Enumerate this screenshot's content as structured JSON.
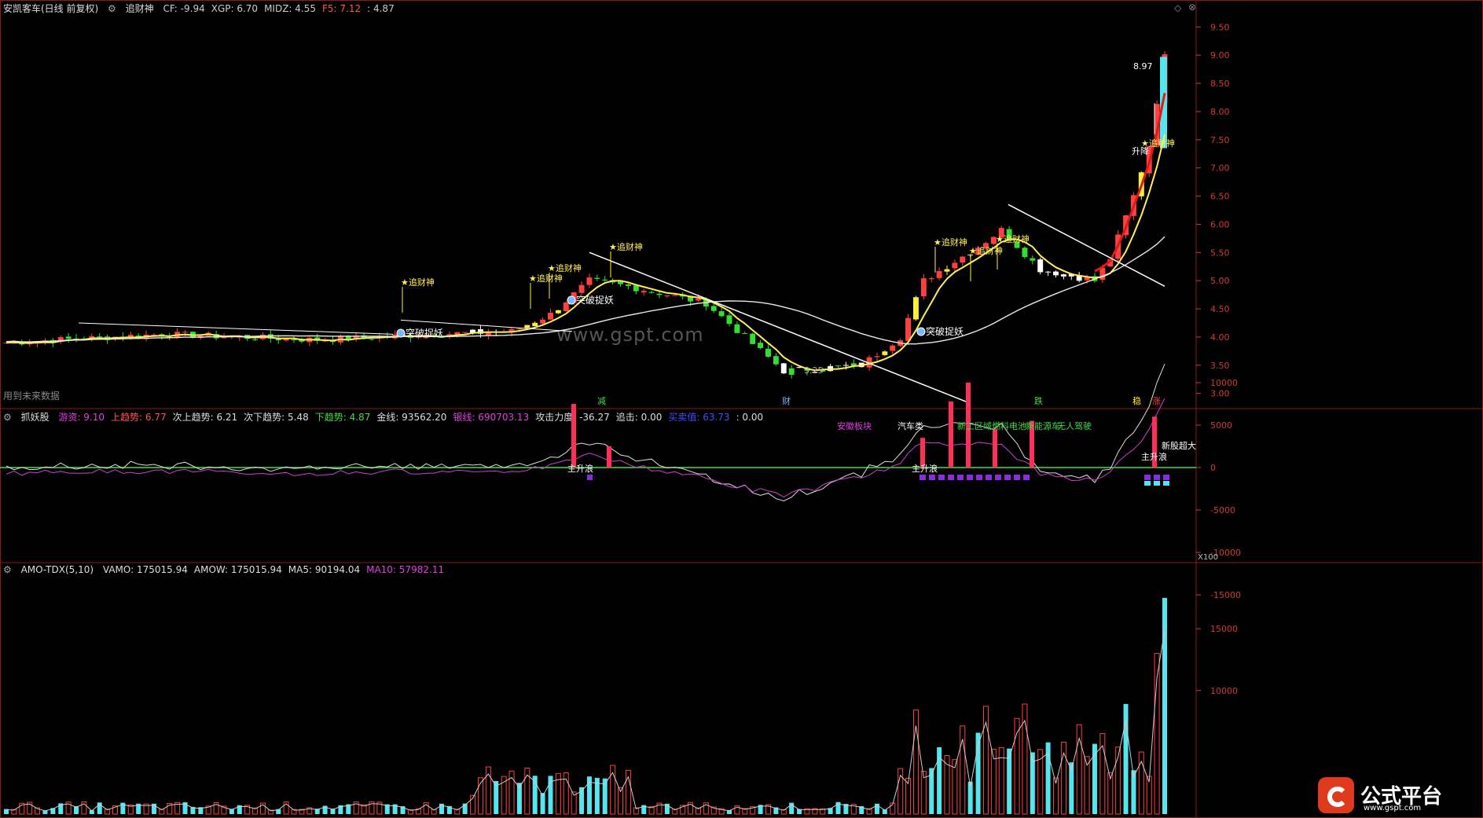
{
  "main": {
    "title": "安凯客车(日线 前复权)",
    "indicator": "追财神",
    "metrics": [
      {
        "label": "CF:",
        "value": "-9.94",
        "color": "#cccccc"
      },
      {
        "label": "XGP:",
        "value": "6.70",
        "color": "#cccccc"
      },
      {
        "label": "MIDZ:",
        "value": "4.55",
        "color": "#cccccc"
      },
      {
        "label": "F5:",
        "value": "7.12",
        "color": "#ff5555"
      },
      {
        "label": ":",
        "value": "4.87",
        "color": "#cccccc"
      }
    ],
    "yaxis": [
      "9.50",
      "9.00",
      "8.50",
      "8.00",
      "7.50",
      "7.00",
      "6.50",
      "6.00",
      "5.50",
      "5.00",
      "4.50",
      "4.00",
      "3.50",
      "3.00"
    ],
    "annotations": {
      "zhuicaishen": "追财神",
      "tupo": "突破捉妖",
      "high_label": "8.97",
      "low_label": "3.25",
      "shengjiang": "升降",
      "future_data": "用到未来数据",
      "bottom_tags": [
        "减",
        "财",
        "跌",
        "稳",
        "涨"
      ],
      "watermark": "www.gspt.com"
    }
  },
  "sub1": {
    "name": "抓妖股",
    "metrics": [
      {
        "label": "游资:",
        "value": "9.10",
        "color": "#e040e0"
      },
      {
        "label": "上趋势:",
        "value": "6.77",
        "color": "#ff5555"
      },
      {
        "label": "次上趋势:",
        "value": "6.21",
        "color": "#dddddd"
      },
      {
        "label": "次下趋势:",
        "value": "5.48",
        "color": "#dddddd"
      },
      {
        "label": "下趋势:",
        "value": "4.87",
        "color": "#44dd44"
      },
      {
        "label": "金线:",
        "value": "93562.20",
        "color": "#dddddd"
      },
      {
        "label": "银线:",
        "value": "690703.13",
        "color": "#e040e0"
      },
      {
        "label": "攻击力度:",
        "value": "-36.27",
        "color": "#dddddd"
      },
      {
        "label": "追击:",
        "value": "0.00",
        "color": "#dddddd"
      },
      {
        "label": "买卖值:",
        "value": "63.73",
        "color": "#4a4aff"
      },
      {
        "label": ":",
        "value": "0.00",
        "color": "#dddddd"
      }
    ],
    "yaxis": [
      "10000",
      "5000",
      "0",
      "-5000",
      "-10000",
      "-15000"
    ],
    "scale_label": "X100",
    "sector_tags": [
      {
        "text": "安徽板块",
        "color": "#e040e0"
      },
      {
        "text": "汽车类",
        "color": "#ffffff"
      },
      {
        "text": "新工区域",
        "color": "#44dd44"
      },
      {
        "text": "燃料电池",
        "color": "#44dd44"
      },
      {
        "text": "新能源车",
        "color": "#44dd44"
      },
      {
        "text": "无人驾驶",
        "color": "#44dd44"
      }
    ],
    "labels": {
      "zhusheng": "主升浪",
      "xingu": "新股超大",
      "zhusheng2": "主升浪"
    }
  },
  "sub2": {
    "name": "AMO-TDX(5,10)",
    "metrics": [
      {
        "label": "VAMO:",
        "value": "175015.94",
        "color": "#dddddd"
      },
      {
        "label": "AMOW:",
        "value": "175015.94",
        "color": "#dddddd"
      },
      {
        "label": "MA5:",
        "value": "90194.04",
        "color": "#dddddd"
      },
      {
        "label": "MA10:",
        "value": "57982.11",
        "color": "#e040e0"
      }
    ],
    "yaxis": [
      "15000",
      "10000"
    ]
  },
  "logo": {
    "text": "公式平台",
    "sub": "www.gspt.com"
  },
  "chart_data": {
    "type": "candlestick",
    "ylim": [
      2.8,
      9.7
    ],
    "close_start": 3.9,
    "close_end": 8.97,
    "y_ticks": [
      9.5,
      9.0,
      8.5,
      8.0,
      7.5,
      7.0,
      6.5,
      6.0,
      5.5,
      5.0,
      4.5,
      4.0,
      3.5,
      3.0
    ]
  }
}
